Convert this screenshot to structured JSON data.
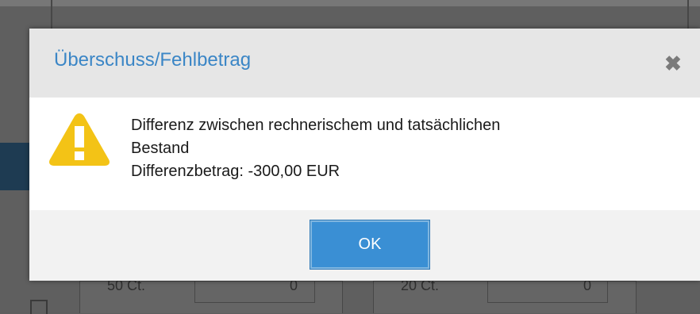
{
  "background": {
    "left_cell_text": "50 Ct.",
    "right_cell_text": "20 Ct.",
    "left_value": "0",
    "right_value": "0"
  },
  "dialog": {
    "title": "Überschuss/Fehlbetrag",
    "close_glyph": "✖",
    "icon": "warning-icon",
    "message_line1": "Differenz zwischen rechnerischem und tatsächlichen",
    "message_line2": "Bestand",
    "message_line3": "Differenzbetrag: -300,00 EUR",
    "ok_label": "OK"
  },
  "colors": {
    "title": "#3b86c6",
    "ok_button": "#3a8fd4",
    "warning": "#f3c316"
  }
}
